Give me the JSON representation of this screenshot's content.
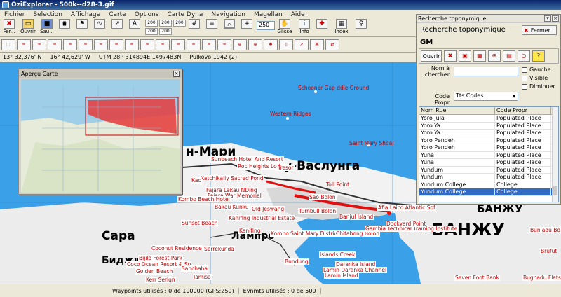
{
  "window": {
    "title": "OziExplorer - 500k--d28-3.gif"
  },
  "menu": [
    "Fichier",
    "Selection",
    "Affichage",
    "Carte",
    "Options",
    "Carte Dyna",
    "Navigation",
    "Magellan",
    "Aide"
  ],
  "toolbar": {
    "buttons": [
      "Fer...",
      "Ouvrir",
      "Sau...",
      "Glisse",
      "Info",
      "Index"
    ],
    "small": [
      "200",
      "200",
      "200",
      "200",
      "200"
    ],
    "zoom": "250"
  },
  "coords": {
    "lat": "13° 32,376' N",
    "lon": "16° 42,629' W",
    "utm": "UTM  28P   314894E   1497483N",
    "datum": "Pulkovo 1942 (2)"
  },
  "overview": {
    "title": "Aperçu Carte"
  },
  "map": {
    "big_labels": [
      "н-Мари",
      "у-Васлунга",
      "Сара",
      "Лампро",
      "БАНЖУ",
      "БАНЖУ",
      "Биджи"
    ],
    "labels": [
      "Schooner Gap ddle Ground",
      "Western Ridges",
      "Saint Mary Shoal",
      "Sunbeach Hotel And Resort",
      "Roc Heights Lodge",
      "Tresor",
      "Katchikally Sacred Pond",
      "Kac",
      "Toll Point",
      "Fajara Lakau NDing",
      "Fajara War Memorial",
      "Sao Bolon",
      "Kombo Beach Hotel",
      "Bakau Kunku",
      "Old Jeswang",
      "Turnbull Bolon",
      "Afia Laico Atlantic Sof",
      "Banjul Island",
      "Sunset Beach",
      "Kanifing Industrial Estate",
      "Kombo Saint Mary District",
      "Kanifing",
      "Chitabong Bolon",
      "Gambia Technical Training Institute",
      "Coconut Residence",
      "Serrekunda",
      "Islands Creek",
      "Bijilo Forest Park",
      "Coco Ocean Resort & Sp",
      "Golden Beach",
      "Bundung",
      "Daranka Island",
      "Lamin Daranka Channel",
      "Lamin Island",
      "Seven Foot Bank",
      "Bugnadu Flats",
      "Buniadu Bo",
      "Brufut",
      "Kerr Seriqn",
      "Jamisa",
      "Sanchaba",
      "Dockyard Point"
    ]
  },
  "panel": {
    "title": "Recherche toponymique",
    "heading": "Recherche toponymique",
    "close_label": "Fermer",
    "code": "GM",
    "open_label": "Ouvrir",
    "name_label": "Nom à chercher",
    "code_label": "Code Propr",
    "code_select": "Tts Codes",
    "checks": [
      "Gauche",
      "Visible",
      "Diminuer"
    ],
    "columns": [
      "Nom Rue",
      "Code Propr"
    ],
    "rows": [
      [
        "Yoro Jula",
        "Populated Place"
      ],
      [
        "Yoro Ya",
        "Populated Place"
      ],
      [
        "Yoro Ya",
        "Populated Place"
      ],
      [
        "Yoro Pendeh",
        "Populated Place"
      ],
      [
        "Yoro Pendeh",
        "Populated Place"
      ],
      [
        "Yuna",
        "Populated Place"
      ],
      [
        "Yuna",
        "Populated Place"
      ],
      [
        "Yundum",
        "Populated Place"
      ],
      [
        "Yundum",
        "Populated Place"
      ],
      [
        "Yundum College",
        "College"
      ],
      [
        "Yundum College",
        "College"
      ]
    ]
  },
  "status": {
    "waypoints": "Waypoints utilisés : 0 de 100000   (GPS:250)",
    "events": "Evnmts utilisés : 0 de 500"
  }
}
